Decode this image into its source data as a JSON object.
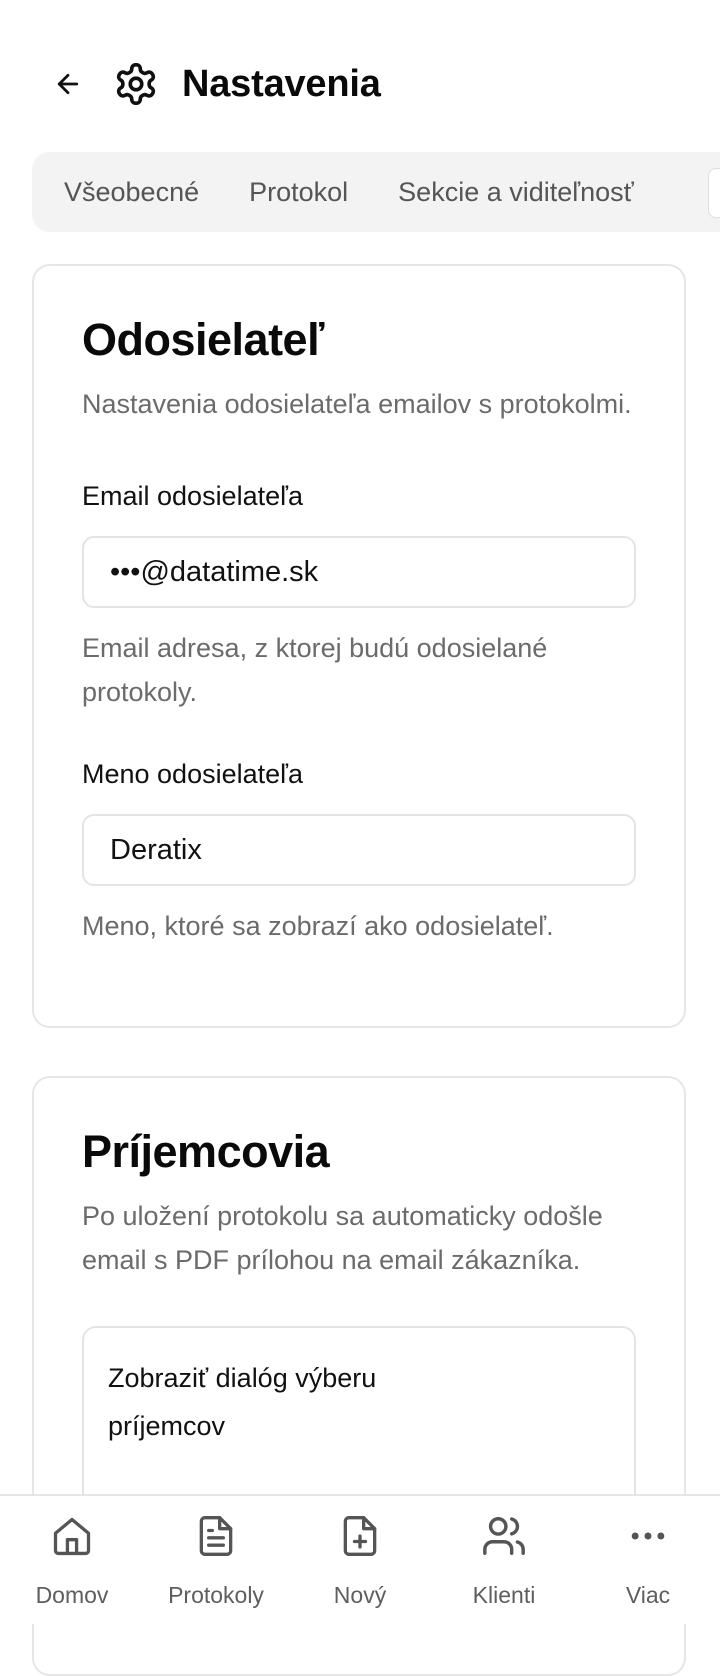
{
  "header": {
    "title": "Nastavenia"
  },
  "tabs": [
    {
      "label": "Všeobecné"
    },
    {
      "label": "Protokol"
    },
    {
      "label": "Sekcie a viditeľnosť"
    }
  ],
  "sender_card": {
    "title": "Odosielateľ",
    "description": "Nastavenia odosielateľa emailov s protokolmi.",
    "email_label": "Email odosielateľa",
    "email_value": "•••@datatime.sk",
    "email_helper": "Email adresa, z ktorej budú odosielané protokoly.",
    "name_label": "Meno odosielateľa",
    "name_value": "Deratix",
    "name_helper": "Meno, ktoré sa zobrazí ako odosielateľ."
  },
  "recipients_card": {
    "title": "Príjemcovia",
    "description": "Po uložení protokolu sa automaticky odošle email s PDF prílohou na email zákazníka.",
    "dialog_option_label": "Zobraziť dialóg výberu príjemcov"
  },
  "bottom_nav": [
    {
      "label": "Domov",
      "icon": "home-icon"
    },
    {
      "label": "Protokoly",
      "icon": "document-icon"
    },
    {
      "label": "Nový",
      "icon": "file-plus-icon"
    },
    {
      "label": "Klienti",
      "icon": "users-icon"
    },
    {
      "label": "Viac",
      "icon": "more-icon"
    }
  ]
}
